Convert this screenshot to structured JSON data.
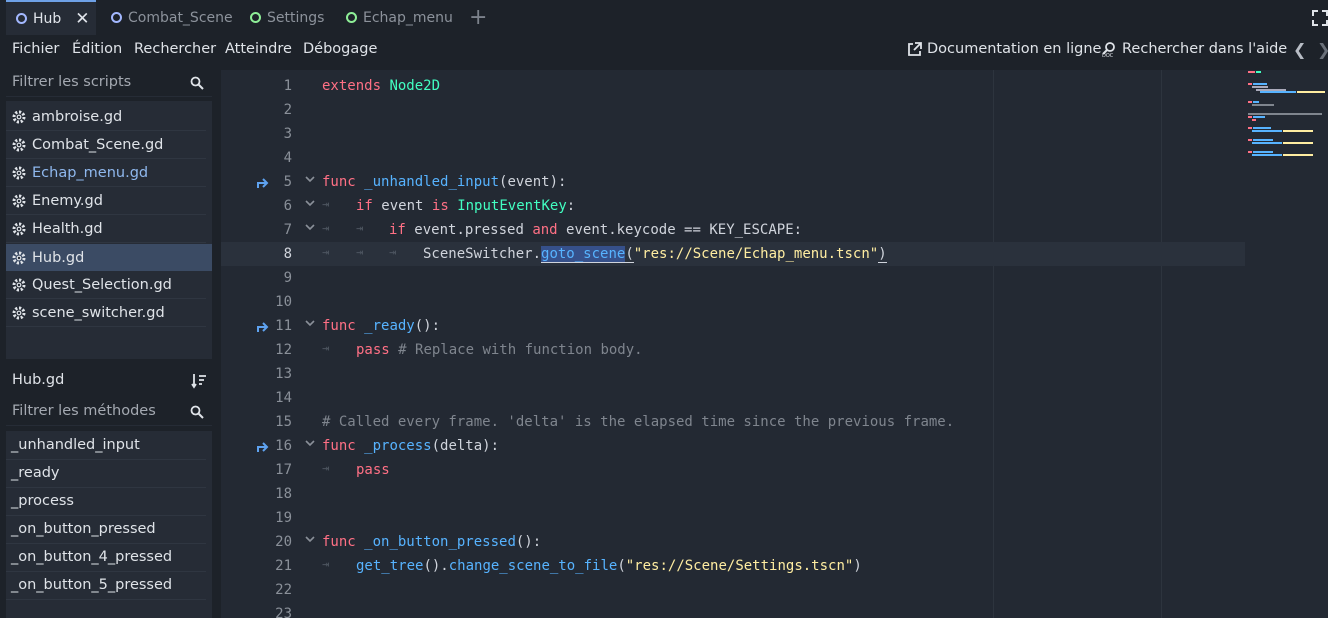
{
  "tabs": [
    {
      "label": "Hub",
      "active": true,
      "dot_color": "#a3b8ff"
    },
    {
      "label": "Combat_Scene",
      "active": false,
      "dot_color": "#a3b8ff"
    },
    {
      "label": "Settings",
      "active": false,
      "dot_color": "#8eef97"
    },
    {
      "label": "Echap_menu",
      "active": false,
      "dot_color": "#8eef97"
    }
  ],
  "menu": {
    "items": [
      "Fichier",
      "Édition",
      "Rechercher",
      "Atteindre",
      "Débogage"
    ],
    "online_docs": "Documentation en ligne",
    "search_help": "Rechercher dans l'aide"
  },
  "scripts": {
    "filter_placeholder": "Filtrer les scripts",
    "items": [
      "ambroise.gd",
      "Combat_Scene.gd",
      "Echap_menu.gd",
      "Enemy.gd",
      "Health.gd",
      "Hub.gd",
      "Quest_Selection.gd",
      "scene_switcher.gd"
    ],
    "selected": "Hub.gd"
  },
  "current_script": "Hub.gd",
  "methods": {
    "filter_placeholder": "Filtrer les méthodes",
    "items": [
      "_unhandled_input",
      "_ready",
      "_process",
      "_on_button_pressed",
      "_on_button_4_pressed",
      "_on_button_5_pressed"
    ]
  },
  "code": {
    "line_numbers": [
      "1",
      "2",
      "3",
      "4",
      "5",
      "6",
      "7",
      "8",
      "9",
      "10",
      "11",
      "12",
      "13",
      "14",
      "15",
      "16",
      "17",
      "18",
      "19",
      "20",
      "21",
      "22",
      "23"
    ],
    "tokens": {
      "extends": "extends",
      "node2d": "Node2D",
      "func": "func",
      "unhandled_input": "_unhandled_input",
      "event_args": "(event):",
      "if": "if",
      "event": "event",
      "is": "is",
      "input_event_key": "InputEventKey",
      "colon": ":",
      "event_pressed": "event.pressed",
      "and": "and",
      "keycode_cmp": "event.keycode == KEY_ESCAPE:",
      "scene_switcher": "SceneSwitcher.",
      "goto_scene": "goto_scene",
      "paren_open": "(",
      "echap_path": "\"res://Scene/Echap_menu.tscn\"",
      "paren_close": ")",
      "ready": "_ready",
      "empty_args": "():",
      "pass": "pass",
      "replace_comment": "# Replace with function body.",
      "called_comment": "# Called every frame. 'delta' is the elapsed time since the previous frame.",
      "process": "_process",
      "delta_args": "(delta):",
      "on_button_pressed": "_on_button_pressed",
      "get_tree": "get_tree",
      "get_tree_parens": "().",
      "change_scene": "change_scene_to_file",
      "settings_path": "\"res://Scene/Settings.tscn\"",
      "close": ")"
    }
  }
}
